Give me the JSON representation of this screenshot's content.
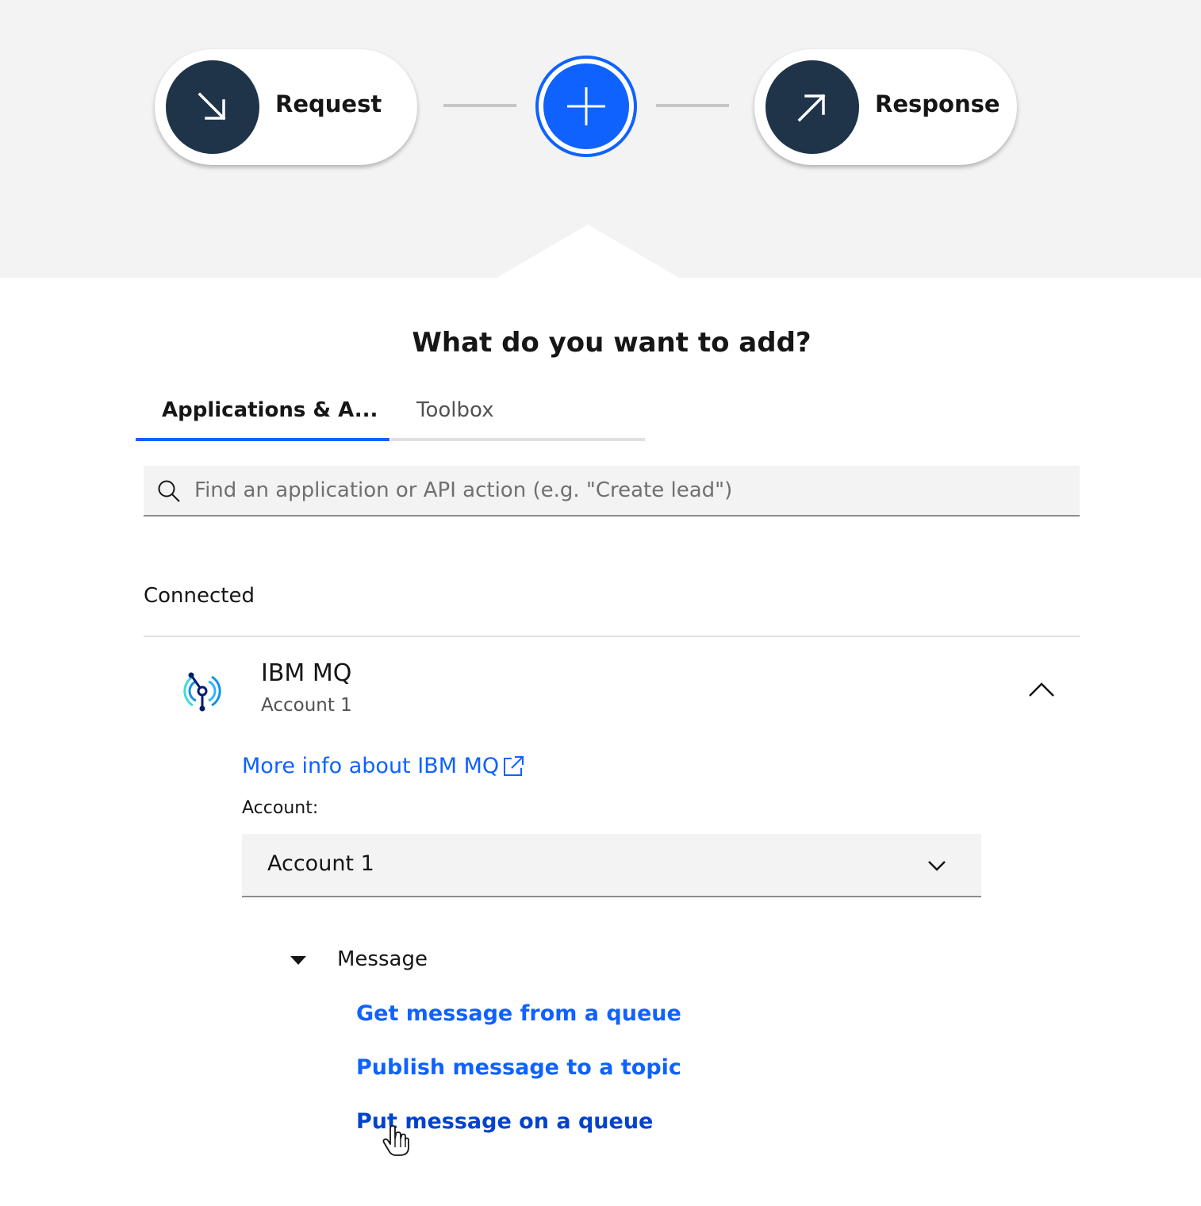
{
  "flow": {
    "request": {
      "label": "Request",
      "icon": "arrow-down-right-icon"
    },
    "add": {
      "icon": "plus-icon"
    },
    "response": {
      "label": "Response",
      "icon": "arrow-up-right-icon"
    }
  },
  "panel": {
    "title": "What do you want to add?",
    "tabs": [
      {
        "label": "Applications & A...",
        "selected": true
      },
      {
        "label": "Toolbox",
        "selected": false
      }
    ],
    "search": {
      "placeholder": "Find an application or API action (e.g. \"Create lead\")",
      "value": ""
    },
    "section_label": "Connected",
    "app": {
      "name": "IBM MQ",
      "account_subtitle": "Account 1",
      "more_info": "More info about IBM MQ",
      "account_label": "Account:",
      "account_selected": "Account 1",
      "group": {
        "label": "Message",
        "expanded": true,
        "actions": [
          "Get message from a queue",
          "Publish message to a topic",
          "Put message on a queue"
        ]
      }
    }
  },
  "colors": {
    "accent": "#0f62fe",
    "accent_hover": "#0043ce",
    "node_dark": "#1f3449",
    "canvas_bg": "#f3f3f3"
  }
}
